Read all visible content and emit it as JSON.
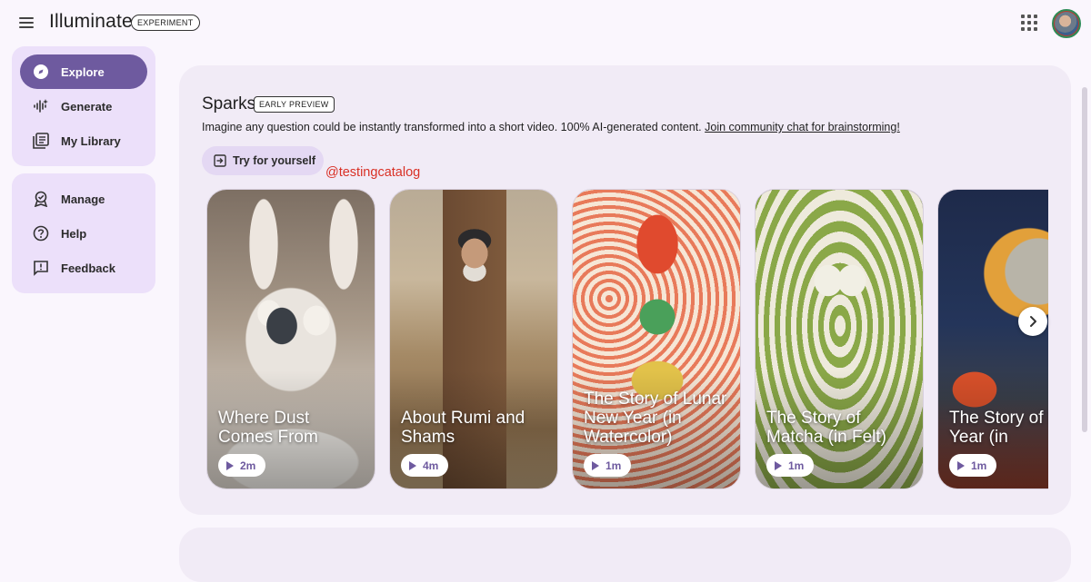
{
  "header": {
    "app_title": "Illuminate",
    "badge": "EXPERIMENT",
    "icons": {
      "menu": "menu-icon",
      "apps": "apps-grid-icon",
      "avatar": "account-avatar"
    }
  },
  "sidebar": {
    "primary": [
      {
        "label": "Explore",
        "icon": "compass-icon",
        "active": true
      },
      {
        "label": "Generate",
        "icon": "sparkle-waveform-icon",
        "active": false
      },
      {
        "label": "My Library",
        "icon": "library-icon",
        "active": false
      }
    ],
    "secondary": [
      {
        "label": "Manage",
        "icon": "manage-badge-icon"
      },
      {
        "label": "Help",
        "icon": "help-icon"
      },
      {
        "label": "Feedback",
        "icon": "feedback-icon"
      }
    ]
  },
  "sparks": {
    "title": "Sparks",
    "badge": "EARLY PREVIEW",
    "description": "Imagine any question could be instantly transformed into a short video. 100% AI-generated content.",
    "link_text": "Join community chat for brainstorming!",
    "try_button": "Try for yourself",
    "watermark": "@testingcatalog",
    "cards": [
      {
        "title": "Where Dust Comes From",
        "duration": "2m"
      },
      {
        "title": "About Rumi and Shams",
        "duration": "4m"
      },
      {
        "title": "The Story of Lunar New Year (in Watercolor)",
        "duration": "1m"
      },
      {
        "title": "The Story of Matcha (in Felt)",
        "duration": "1m"
      },
      {
        "title": "The Story of New Year (in",
        "duration": "1m"
      }
    ]
  },
  "colors": {
    "accent": "#6e5a9f",
    "nav_bg": "#ece0fa",
    "card_bg": "#f1ebf6",
    "watermark": "#d93025"
  }
}
